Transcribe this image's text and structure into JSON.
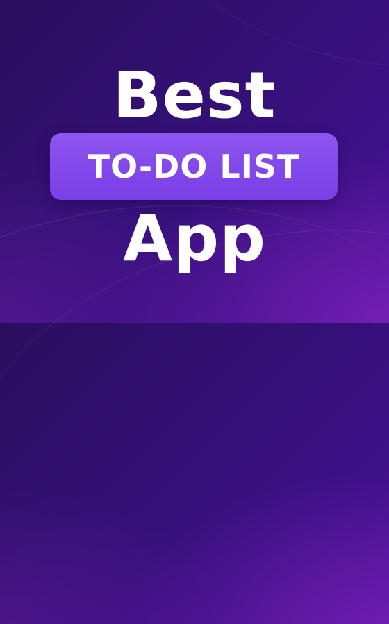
{
  "banner": {
    "line_top": "Best",
    "badge_label": "TO-DO LIST",
    "line_bottom": "App"
  },
  "colors": {
    "background_dark": "#2a0f5e",
    "background_mid": "#3d1088",
    "badge_fill": "#8148ea",
    "text": "#ffffff"
  }
}
